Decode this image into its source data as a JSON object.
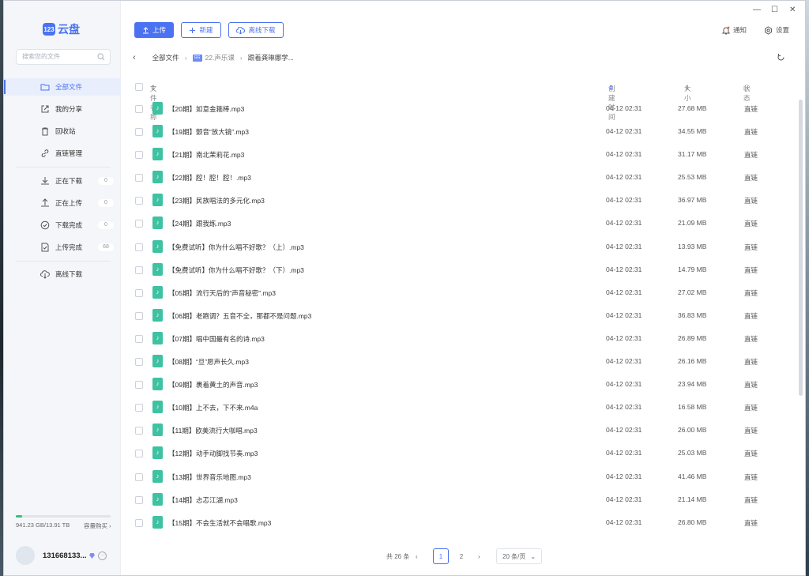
{
  "app": {
    "logo_num": "123",
    "logo_text": "云盘"
  },
  "sidebar": {
    "search_placeholder": "搜索您的文件",
    "nav": [
      {
        "label": "全部文件",
        "icon": "folder-icon"
      },
      {
        "label": "我的分享",
        "icon": "share-icon"
      },
      {
        "label": "回收站",
        "icon": "trash-icon"
      },
      {
        "label": "直链管理",
        "icon": "link-icon"
      }
    ],
    "transfers": [
      {
        "label": "正在下载",
        "icon": "download-icon",
        "count": "0"
      },
      {
        "label": "正在上传",
        "icon": "upload-icon",
        "count": "0"
      },
      {
        "label": "下载完成",
        "icon": "check-circle-icon",
        "count": "0"
      },
      {
        "label": "上传完成",
        "icon": "file-check-icon",
        "count": "68"
      }
    ],
    "offline": {
      "label": "离线下载",
      "icon": "cloud-download-icon"
    },
    "storage": {
      "text": "941.23 GB/13.91 TB",
      "buy_label": "容量购买",
      "used_fraction": 0.066
    },
    "user": {
      "name": "131668133..."
    }
  },
  "toolbar": {
    "upload_label": "上传",
    "new_label": "新建",
    "offline_label": "离线下载",
    "notify_label": "通知",
    "settings_label": "设置"
  },
  "breadcrumb": {
    "root": "全部文件",
    "folder_tag": "GG",
    "folder": "22.声乐课",
    "current": "跟着龚琳娜学..."
  },
  "table": {
    "col_name": "文件名称",
    "col_date": "创建时间",
    "col_size": "大小",
    "col_status": "状态",
    "rows": [
      {
        "name": "【20期】如意金箍棒.mp3",
        "date": "04-12 02:31",
        "size": "27.68 MB",
        "status": "直链"
      },
      {
        "name": "【19期】颤音“放大镜”.mp3",
        "date": "04-12 02:31",
        "size": "34.55 MB",
        "status": "直链"
      },
      {
        "name": "【21期】南北茉莉花.mp3",
        "date": "04-12 02:31",
        "size": "31.17 MB",
        "status": "直链"
      },
      {
        "name": "【22期】腔！腔！腔！.mp3",
        "date": "04-12 02:31",
        "size": "25.53 MB",
        "status": "直链"
      },
      {
        "name": "【23期】民族唱法的多元化.mp3",
        "date": "04-12 02:31",
        "size": "36.97 MB",
        "status": "直链"
      },
      {
        "name": "【24期】跟我练.mp3",
        "date": "04-12 02:31",
        "size": "21.09 MB",
        "status": "直链"
      },
      {
        "name": "【免费试听】你为什么唱不好歌？（上）.mp3",
        "date": "04-12 02:31",
        "size": "13.93 MB",
        "status": "直链"
      },
      {
        "name": "【免费试听】你为什么唱不好歌？（下）.mp3",
        "date": "04-12 02:31",
        "size": "14.79 MB",
        "status": "直链"
      },
      {
        "name": "【05期】流行天后的“声音秘密”.mp3",
        "date": "04-12 02:31",
        "size": "27.02 MB",
        "status": "直链"
      },
      {
        "name": "【06期】老跑调？五音不全，那都不是问题.mp3",
        "date": "04-12 02:31",
        "size": "36.83 MB",
        "status": "直链"
      },
      {
        "name": "【07期】唱中国最有名的诗.mp3",
        "date": "04-12 02:31",
        "size": "26.89 MB",
        "status": "直链"
      },
      {
        "name": "【08期】“旦”愿声长久.mp3",
        "date": "04-12 02:31",
        "size": "26.16 MB",
        "status": "直链"
      },
      {
        "name": "【09期】裹着黄土的声音.mp3",
        "date": "04-12 02:31",
        "size": "23.94 MB",
        "status": "直链"
      },
      {
        "name": "【10期】上不去，下不来.m4a",
        "date": "04-12 02:31",
        "size": "16.58 MB",
        "status": "直链"
      },
      {
        "name": "【11期】欧美流行大咖唱.mp3",
        "date": "04-12 02:31",
        "size": "26.00 MB",
        "status": "直链"
      },
      {
        "name": "【12期】动手动脚找节奏.mp3",
        "date": "04-12 02:31",
        "size": "25.03 MB",
        "status": "直链"
      },
      {
        "name": "【13期】世界音乐地图.mp3",
        "date": "04-12 02:31",
        "size": "41.46 MB",
        "status": "直链"
      },
      {
        "name": "【14期】忐忑江湖.mp3",
        "date": "04-12 02:31",
        "size": "21.14 MB",
        "status": "直链"
      },
      {
        "name": "【15期】不会生活就不会唱歌.mp3",
        "date": "04-12 02:31",
        "size": "26.80 MB",
        "status": "直链"
      }
    ]
  },
  "pager": {
    "total": "共 26 条",
    "page1": "1",
    "page2": "2",
    "page_size": "20 条/页"
  }
}
